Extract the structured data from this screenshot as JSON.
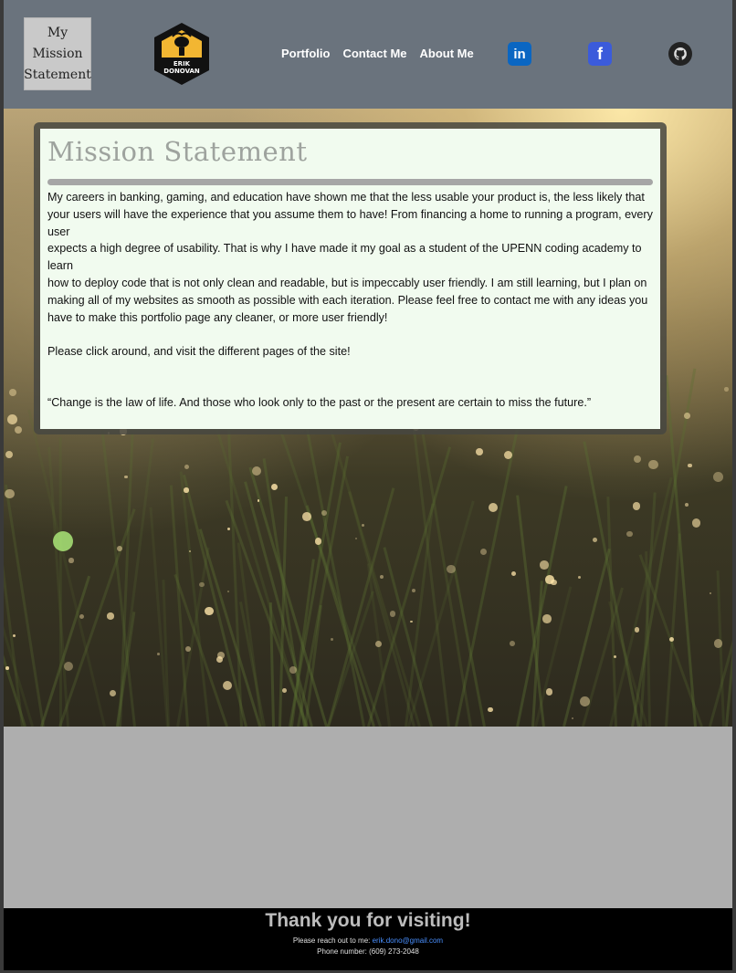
{
  "header": {
    "title_lines": [
      "My",
      "Mission",
      "Statement"
    ],
    "logo_text_lines": [
      "ERIK",
      "DONOVAN"
    ],
    "nav": [
      "Portfolio",
      "Contact Me",
      "About Me"
    ],
    "social": [
      {
        "name": "linkedin-icon",
        "glyph": "in"
      },
      {
        "name": "facebook-icon",
        "glyph": "f"
      },
      {
        "name": "github-icon",
        "glyph": ""
      }
    ]
  },
  "card": {
    "heading": "Mission Statement",
    "paragraphs": [
      "My careers in banking, gaming, and education have shown me that the less usable your product is, the less likely that your users will have the experience that you assume them to have! From financing a home to running a program, every user",
      "expects a high degree of usability. That is why I have made it my goal as a student of the UPENN coding academy to learn",
      "how to deploy code that is not only clean and readable, but is impeccably user friendly. I am still learning, but I plan on making all of my websites as smooth as possible with each iteration. Please feel free to contact me with any ideas you have to make this portfolio page any cleaner, or more user friendly!",
      "Please click around, and visit the different pages of the site!",
      "“Change is the law of life. And those who look only to the past or the present are certain to miss the future.”"
    ]
  },
  "footer": {
    "thanks": "Thank you for visiting!",
    "contact_prefix": "Please reach out to me: ",
    "email": "erik.dono@gmail.com",
    "phone": "Phone number: (609) 273-2048"
  },
  "colors": {
    "header_bg": "#6a737d",
    "card_bg": "#f1fbef",
    "footer_bg": "#000000",
    "link": "#4a90ff"
  }
}
